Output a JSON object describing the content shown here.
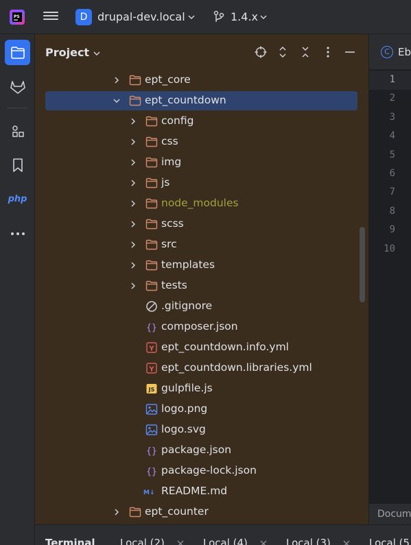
{
  "titlebar": {
    "project_initial": "D",
    "project_name": "drupal-dev.local",
    "branch": "1.4.x"
  },
  "stripe": {
    "php_label": "php"
  },
  "panel": {
    "title": "Project"
  },
  "tree": [
    {
      "label": "ept_core",
      "type": "folder",
      "indent": 0,
      "expanded": false,
      "excluded": false
    },
    {
      "label": "ept_countdown",
      "type": "folder",
      "indent": 0,
      "expanded": true,
      "selected": true,
      "excluded": false
    },
    {
      "label": "config",
      "type": "folder",
      "indent": 1,
      "expanded": false,
      "excluded": false
    },
    {
      "label": "css",
      "type": "folder",
      "indent": 1,
      "expanded": false,
      "excluded": false
    },
    {
      "label": "img",
      "type": "folder",
      "indent": 1,
      "expanded": false,
      "excluded": false
    },
    {
      "label": "js",
      "type": "folder",
      "indent": 1,
      "expanded": false,
      "excluded": false
    },
    {
      "label": "node_modules",
      "type": "folder",
      "indent": 1,
      "expanded": false,
      "excluded": true
    },
    {
      "label": "scss",
      "type": "folder",
      "indent": 1,
      "expanded": false,
      "excluded": false
    },
    {
      "label": "src",
      "type": "folder",
      "indent": 1,
      "expanded": false,
      "excluded": false
    },
    {
      "label": "templates",
      "type": "folder",
      "indent": 1,
      "expanded": false,
      "excluded": false
    },
    {
      "label": "tests",
      "type": "folder",
      "indent": 1,
      "expanded": false,
      "excluded": false
    },
    {
      "label": ".gitignore",
      "type": "ignore",
      "indent": 1
    },
    {
      "label": "composer.json",
      "type": "json",
      "indent": 1
    },
    {
      "label": "ept_countdown.info.yml",
      "type": "yaml",
      "indent": 1
    },
    {
      "label": "ept_countdown.libraries.yml",
      "type": "yaml",
      "indent": 1
    },
    {
      "label": "gulpfile.js",
      "type": "js",
      "indent": 1
    },
    {
      "label": "logo.png",
      "type": "image",
      "indent": 1
    },
    {
      "label": "logo.svg",
      "type": "image",
      "indent": 1
    },
    {
      "label": "package.json",
      "type": "json",
      "indent": 1
    },
    {
      "label": "package-lock.json",
      "type": "json",
      "indent": 1
    },
    {
      "label": "README.md",
      "type": "markdown",
      "indent": 1
    },
    {
      "label": "ept_counter",
      "type": "folder",
      "indent": 0,
      "expanded": false,
      "excluded": false
    }
  ],
  "icons": {
    "yaml_glyph": "Y",
    "js_glyph": "JS",
    "md_glyph": "M↓",
    "json_glyph": "{}"
  },
  "editor": {
    "tab_icon_letter": "C",
    "tab_label": "Eb",
    "line_numbers": [
      "1",
      "2",
      "3",
      "4",
      "5",
      "6",
      "7",
      "8",
      "9",
      "10"
    ],
    "footer_label": "Docum"
  },
  "terminal": {
    "title": "Terminal",
    "tabs": [
      "Local (2)",
      "Local (4)",
      "Local (3)",
      "Local (5"
    ]
  },
  "colors": {
    "accent": "#3574f0",
    "folder": "#d28c6c",
    "excluded": "#a2a23a",
    "selection": "#2e436e",
    "panel_bg": "#3a2d1e"
  }
}
